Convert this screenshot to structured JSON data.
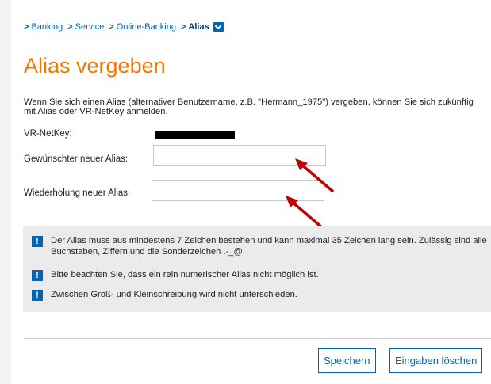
{
  "breadcrumb": {
    "items": [
      "Banking",
      "Service",
      "Online-Banking"
    ],
    "current": "Alias"
  },
  "page": {
    "title": "Alias vergeben",
    "intro": "Wenn Sie sich einen Alias (alternativer Benutzername, z.B. \"Hermann_1975\") vergeben, können Sie sich zukünftig mit Alias oder VR-NetKey anmelden."
  },
  "form": {
    "netkey_label": "VR-NetKey:",
    "new_alias_label": "Gewünschter neuer Alias:",
    "new_alias_value": "",
    "repeat_alias_label": "Wiederholung neuer Alias:",
    "repeat_alias_value": ""
  },
  "info": {
    "items": [
      "Der Alias muss aus mindestens 7 Zeichen bestehen und kann maximal 35 Zeichen lang sein. Zulässig sind alle Buchstaben, Ziffern und die Sonderzeichen .-_@.",
      "Bitte beachten Sie, dass ein rein numerischer Alias nicht möglich ist.",
      "Zwischen Groß- und Kleinschreibung wird nicht unterschieden."
    ],
    "icon_glyph": "!"
  },
  "buttons": {
    "save": "Speichern",
    "clear": "Eingaben löschen"
  },
  "colors": {
    "accent": "#0066b3",
    "title": "#f07800",
    "annotation_arrow": "#c00000"
  }
}
